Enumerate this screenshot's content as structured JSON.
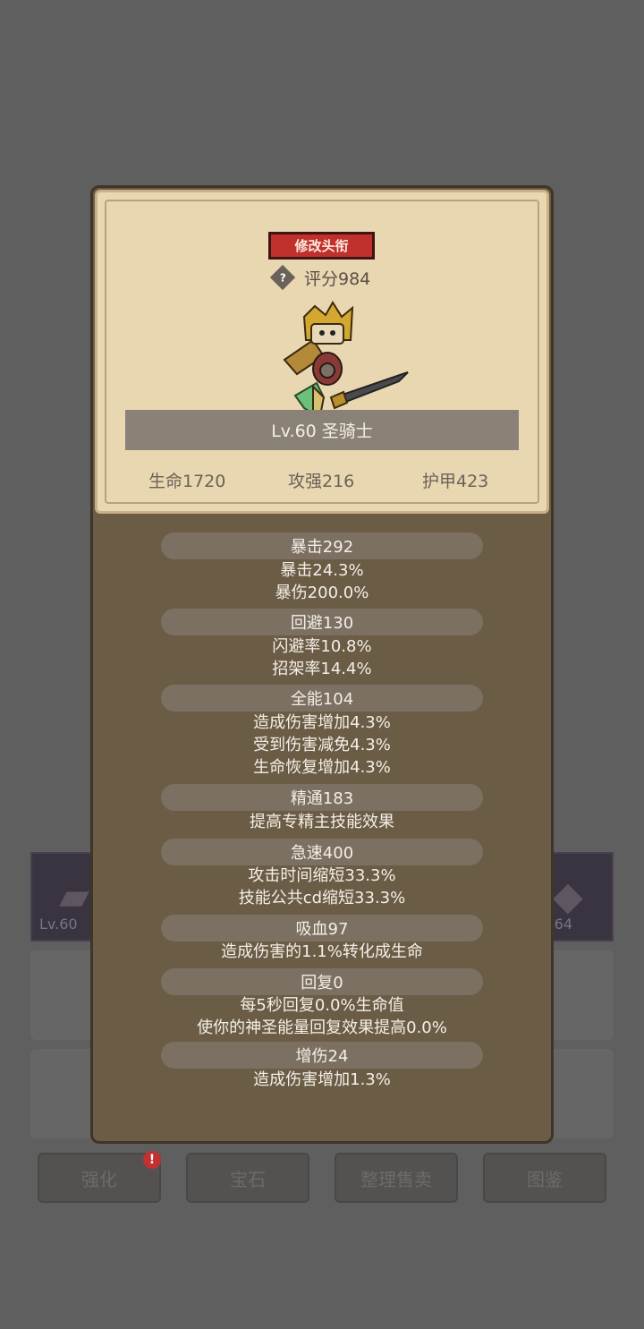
{
  "background": {
    "slot_left_level": "Lv.60",
    "slot_right_level": "64",
    "buttons": [
      {
        "label": "强化",
        "badge": "!"
      },
      {
        "label": "宝石"
      },
      {
        "label": "整理售卖"
      },
      {
        "label": "图鉴"
      }
    ]
  },
  "header": {
    "edit_title_button": "修改头衔",
    "score": "评分984",
    "help_glyph": "?",
    "name": "Lv.60 圣骑士",
    "base_stats": {
      "hp": "生命1720",
      "attack": "攻强216",
      "armor": "护甲423"
    }
  },
  "stats": [
    {
      "title": "暴击292",
      "lines": [
        "暴击24.3%",
        "暴伤200.0%"
      ]
    },
    {
      "title": "回避130",
      "lines": [
        "闪避率10.8%",
        "招架率14.4%"
      ]
    },
    {
      "title": "全能104",
      "lines": [
        "造成伤害增加4.3%",
        "受到伤害减免4.3%",
        "生命恢复增加4.3%"
      ]
    },
    {
      "title": "精通183",
      "lines": [
        "提高专精主技能效果"
      ]
    },
    {
      "title": "急速400",
      "lines": [
        "攻击时间缩短33.3%",
        "技能公共cd缩短33.3%"
      ]
    },
    {
      "title": "吸血97",
      "lines": [
        "造成伤害的1.1%转化成生命"
      ]
    },
    {
      "title": "回复0",
      "lines": [
        "每5秒回复0.0%生命值",
        "使你的神圣能量回复效果提高0.0%"
      ]
    },
    {
      "title": "增伤24",
      "lines": [
        "造成伤害增加1.3%"
      ]
    }
  ]
}
